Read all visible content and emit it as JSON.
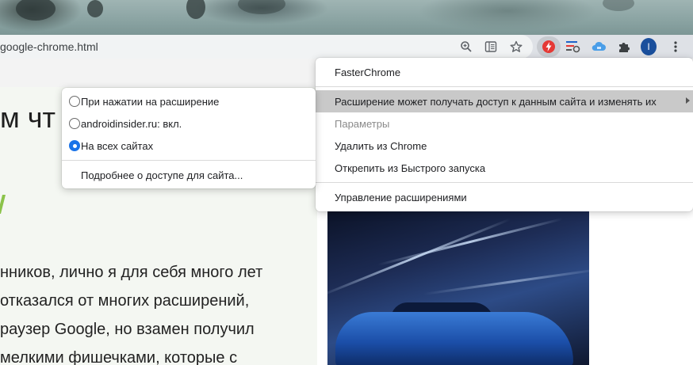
{
  "browser": {
    "url": "google-chrome.html",
    "profile_initial": "I",
    "toolbar_icons": [
      "zoom-icon",
      "reader-mode-icon",
      "bookmark-star-icon",
      "fasterchrome-extension-icon",
      "extension-lines-icon",
      "cloud-extension-icon",
      "puzzle-extensions-icon",
      "profile-avatar",
      "kebab-menu-icon"
    ]
  },
  "page": {
    "heading": "м чт",
    "body_lines": [
      "нников, лично я для себя много лет",
      "отказался от многих расширений,",
      "раузер Google, но взамен получил",
      "мелкими фишечками, которые с"
    ],
    "accent_color": "#8bc34a"
  },
  "extension_menu": {
    "title": "FasterChrome",
    "site_access": "Расширение может получать доступ к данным сайта и изменять их",
    "options": "Параметры",
    "remove": "Удалить из Chrome",
    "unpin": "Открепить из Быстрого запуска",
    "manage": "Управление расширениями"
  },
  "site_access_submenu": {
    "items": [
      {
        "label": "При нажатии на расширение",
        "checked": false
      },
      {
        "label": "androidinsider.ru: вкл.",
        "checked": false
      },
      {
        "label": "На всех сайтах",
        "checked": true
      }
    ],
    "more": "Подробнее о доступе для сайта..."
  },
  "colors": {
    "accent": "#1a73e8",
    "extension_red": "#e53935",
    "avatar": "#1a4f9c"
  }
}
